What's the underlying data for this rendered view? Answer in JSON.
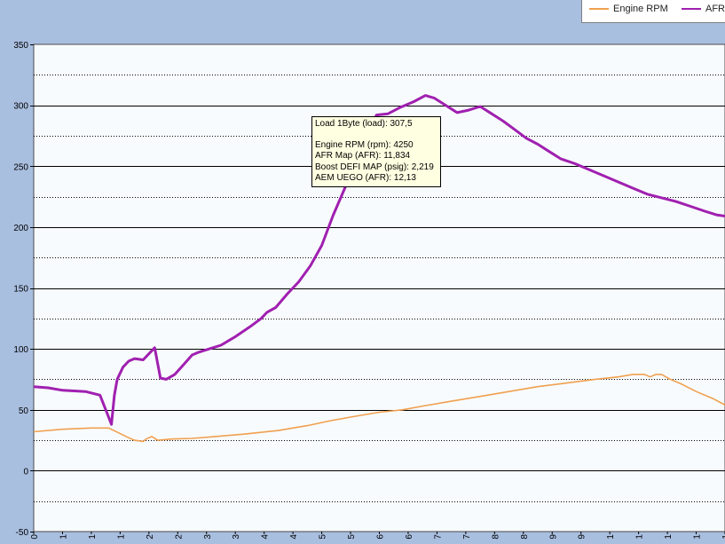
{
  "chart_data": {
    "type": "line",
    "title": "",
    "xlabel": "",
    "ylabel": "",
    "ylim": [
      -50,
      350
    ],
    "xlim": [
      0,
      24
    ],
    "y_ticks": [
      "-50",
      "0",
      "50",
      "100",
      "150",
      "200",
      "250",
      "300",
      "350"
    ],
    "x_tick_labels": [
      "0",
      "1",
      "1",
      "1",
      "2",
      "2",
      "3",
      "3",
      "4",
      "4",
      "5",
      "5",
      "6",
      "6",
      "7",
      "7",
      "8",
      "8",
      "9",
      "9",
      "1",
      "1",
      "1",
      "1",
      "1"
    ],
    "grid": true,
    "legend_position": "top-right",
    "series": [
      {
        "name": "Engine RPM",
        "color": "#f0a050",
        "points": [
          [
            0,
            32
          ],
          [
            1,
            34
          ],
          [
            2,
            35
          ],
          [
            2.6,
            35
          ],
          [
            3.3,
            27
          ],
          [
            3.5,
            25
          ],
          [
            3.8,
            24
          ],
          [
            3.9,
            26
          ],
          [
            4.1,
            28
          ],
          [
            4.3,
            25
          ],
          [
            4.8,
            26
          ],
          [
            5.5,
            26.5
          ],
          [
            6.3,
            28
          ],
          [
            7.3,
            30
          ],
          [
            8.5,
            33
          ],
          [
            9.5,
            37
          ],
          [
            10.3,
            41
          ],
          [
            11,
            44
          ],
          [
            12,
            48
          ],
          [
            12.8,
            50
          ],
          [
            13.5,
            53
          ],
          [
            14.5,
            57
          ],
          [
            15.5,
            61
          ],
          [
            16.5,
            65
          ],
          [
            17.5,
            69
          ],
          [
            18.5,
            72
          ],
          [
            19.5,
            75
          ],
          [
            20.3,
            77
          ],
          [
            20.8,
            79
          ],
          [
            21.2,
            79
          ],
          [
            21.4,
            77
          ],
          [
            21.6,
            79
          ],
          [
            21.8,
            79
          ],
          [
            22.1,
            75
          ],
          [
            22.5,
            71
          ],
          [
            23,
            65
          ],
          [
            23.6,
            59
          ],
          [
            24,
            54
          ]
        ]
      },
      {
        "name": "AFR",
        "color": "#a020b0",
        "points": [
          [
            0,
            69
          ],
          [
            0.5,
            68
          ],
          [
            1,
            66
          ],
          [
            1.8,
            65
          ],
          [
            2.3,
            62
          ],
          [
            2.7,
            38
          ],
          [
            2.8,
            62
          ],
          [
            2.9,
            75
          ],
          [
            3.1,
            85
          ],
          [
            3.3,
            90
          ],
          [
            3.5,
            92
          ],
          [
            3.8,
            91
          ],
          [
            4.2,
            101
          ],
          [
            4.4,
            76
          ],
          [
            4.6,
            75
          ],
          [
            4.9,
            79
          ],
          [
            5.2,
            87
          ],
          [
            5.5,
            95
          ],
          [
            5.7,
            97
          ],
          [
            6.1,
            100
          ],
          [
            6.5,
            103
          ],
          [
            7,
            110
          ],
          [
            7.5,
            118
          ],
          [
            7.9,
            125
          ],
          [
            8.1,
            130
          ],
          [
            8.4,
            134
          ],
          [
            8.8,
            145
          ],
          [
            9.2,
            155
          ],
          [
            9.6,
            168
          ],
          [
            10,
            185
          ],
          [
            10.4,
            210
          ],
          [
            10.8,
            232
          ],
          [
            11.2,
            255
          ],
          [
            11.6,
            280
          ],
          [
            11.9,
            292
          ],
          [
            12.3,
            293
          ],
          [
            12.7,
            298
          ],
          [
            13.2,
            303
          ],
          [
            13.6,
            308
          ],
          [
            13.9,
            306
          ],
          [
            14.3,
            300
          ],
          [
            14.7,
            294
          ],
          [
            15.1,
            296
          ],
          [
            15.5,
            299
          ],
          [
            15.9,
            293
          ],
          [
            16.3,
            287
          ],
          [
            16.7,
            280
          ],
          [
            17.1,
            273
          ],
          [
            17.5,
            268
          ],
          [
            17.9,
            262
          ],
          [
            18.3,
            256
          ],
          [
            18.8,
            252
          ],
          [
            19.3,
            247
          ],
          [
            19.8,
            242
          ],
          [
            20.3,
            237
          ],
          [
            20.8,
            232
          ],
          [
            21.3,
            227
          ],
          [
            21.8,
            224
          ],
          [
            22.3,
            221
          ],
          [
            22.8,
            217
          ],
          [
            23.3,
            213
          ],
          [
            23.7,
            210
          ],
          [
            24,
            209
          ]
        ]
      }
    ]
  },
  "legend": {
    "items": [
      {
        "label": "Engine RPM",
        "color": "#f0a050"
      },
      {
        "label": "AFR",
        "color": "#a020b0"
      }
    ]
  },
  "tooltip": {
    "load_line": "Load 1Byte (load): 307,5",
    "rpm_line": "Engine RPM (rpm): 4250",
    "afr_map_line": "AFR Map (AFR): 11,834",
    "boost_line": "Boost DEFI MAP (psig): 2,219",
    "uego_line": "AEM UEGO (AFR): 12,13"
  }
}
